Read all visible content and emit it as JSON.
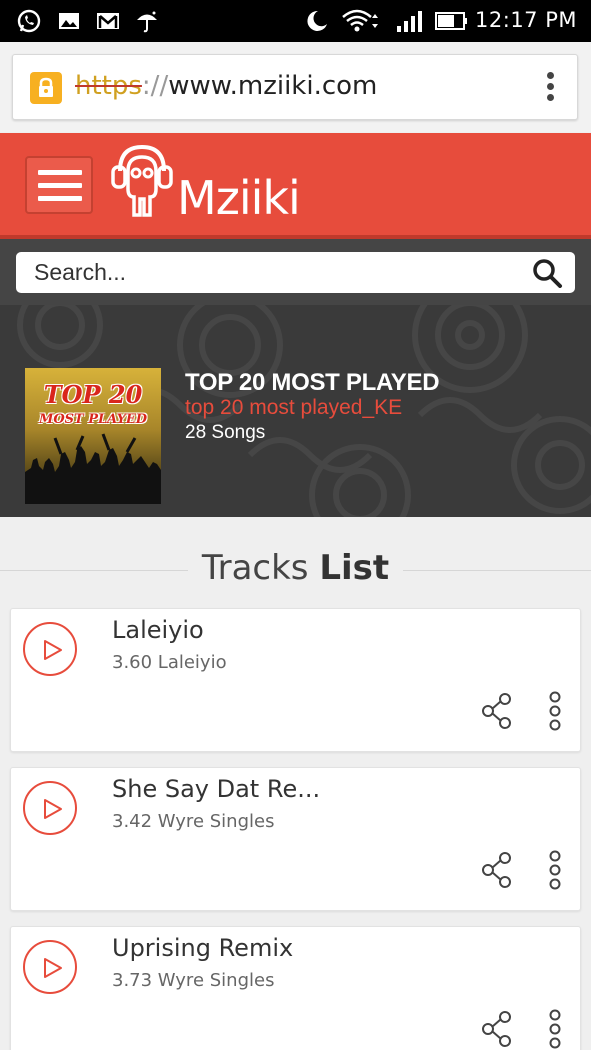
{
  "status_bar": {
    "time": "12:17 PM",
    "icons": [
      "whatsapp-icon",
      "gallery-icon",
      "gmail-icon",
      "umbrella-icon",
      "moon-icon",
      "wifi-icon",
      "signal-icon",
      "battery-icon"
    ]
  },
  "browser": {
    "url_scheme": "https",
    "url_separator": "://",
    "url_host": "www.mziiki.com",
    "menu_icon": "overflow-menu-icon"
  },
  "header": {
    "brand": "Mziiki",
    "menu_icon": "hamburger-menu-icon",
    "colors": {
      "primary": "#e74c3c",
      "dark": "#c0392b"
    }
  },
  "search": {
    "placeholder": "Search...",
    "icon": "search-icon"
  },
  "playlist": {
    "cover_title": "TOP 20",
    "cover_subtitle": "MOST PLAYED",
    "title": "TOP 20 MOST PLAYED",
    "subtitle": "top 20 most played_KE",
    "count": "28 Songs"
  },
  "tracks_heading": {
    "light": "Tracks",
    "bold": "List"
  },
  "tracks": [
    {
      "title": "Laleiyio",
      "meta": "3.60 Laleiyio"
    },
    {
      "title": "She Say Dat Re...",
      "meta": "3.42 Wyre Singles"
    },
    {
      "title": "Uprising Remix",
      "meta": "3.73 Wyre Singles"
    }
  ]
}
